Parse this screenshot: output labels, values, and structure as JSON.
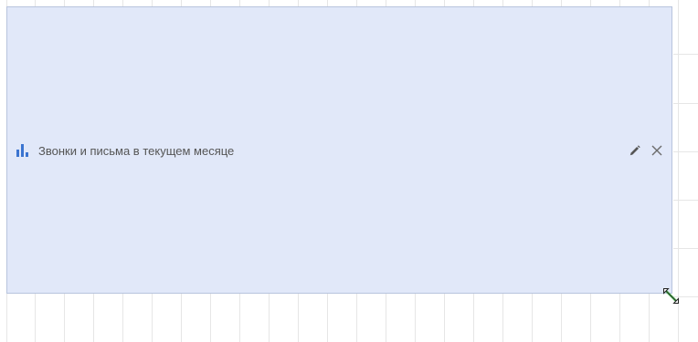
{
  "widget": {
    "title": "Звонки и письма в текущем месяце",
    "icon": "bar-chart-icon",
    "actions": {
      "edit_icon": "pencil-icon",
      "close_icon": "close-icon"
    },
    "resize_icon": "resize-diagonal-icon"
  },
  "colors": {
    "widget_background": "#e1e8f9",
    "widget_border": "#b8c4dd",
    "chart_icon": "#3b74d0",
    "title_text": "#555555",
    "grid_lines": "#e6e6e6",
    "resize_accent": "#4caf50"
  }
}
